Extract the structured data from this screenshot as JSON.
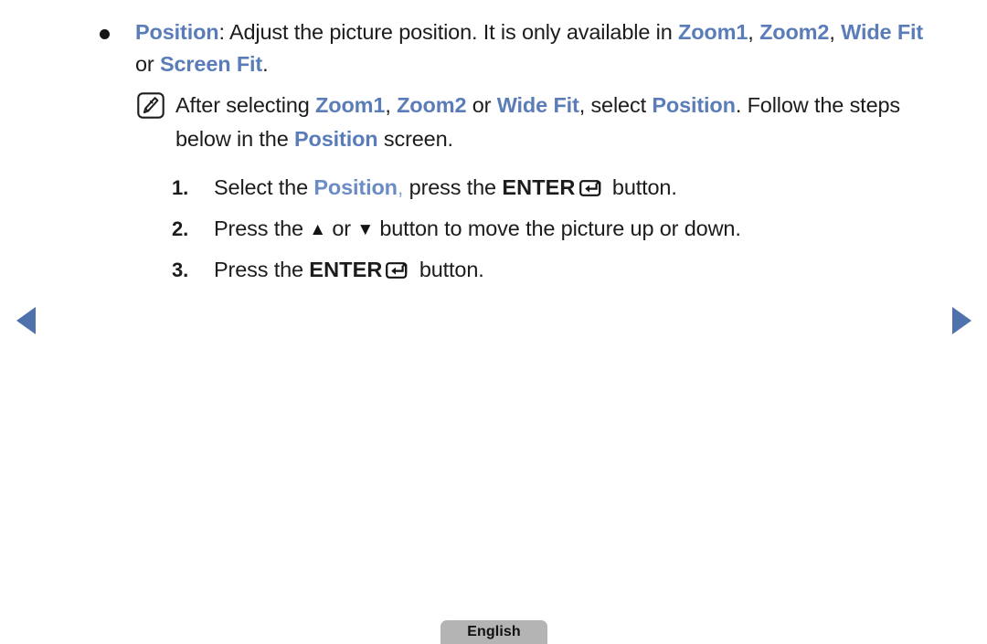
{
  "page": {
    "accent_blue": "#5a7cb8",
    "text_color": "#1c1c1c",
    "background": "#ffffff"
  },
  "bullet": {
    "term": "Position",
    "after_term": ": Adjust the picture position. It is only available in ",
    "opt1": "Zoom1",
    "sep1": ", ",
    "opt2": "Zoom2",
    "sep2": ",",
    "opt3": "Wide Fit",
    "sep3": " or ",
    "opt4": "Screen Fit",
    "end": "."
  },
  "note": {
    "icon_name": "note-pencil-icon",
    "lead": "After selecting ",
    "opt1": "Zoom1",
    "sep1": ", ",
    "opt2": "Zoom2",
    "sep2": " or ",
    "opt3": "Wide Fit",
    "mid": ", select ",
    "term": "Position",
    "tail": ". Follow the steps below in the ",
    "term2": "Position",
    "end": " screen."
  },
  "steps": [
    {
      "number": "1.",
      "lead": "Select the ",
      "keyword": "Position",
      "comma": ",",
      "mid": " press the ",
      "bold": "ENTER",
      "key_icon": "enter-key-icon",
      "tail": " button."
    },
    {
      "number": "2.",
      "lead": "Press the ",
      "up_arrow": "▲",
      "between": " or ",
      "down_arrow": "▼",
      "tail": " button to move the picture up or down."
    },
    {
      "number": "3.",
      "lead": "Press the ",
      "bold": "ENTER",
      "key_icon": "enter-key-icon",
      "tail": " button."
    }
  ],
  "nav": {
    "prev_label": "previous-page",
    "next_label": "next-page",
    "arrow_color": "#4f72ad"
  },
  "language_button": {
    "label": "English",
    "background": "#b4b4b4"
  }
}
